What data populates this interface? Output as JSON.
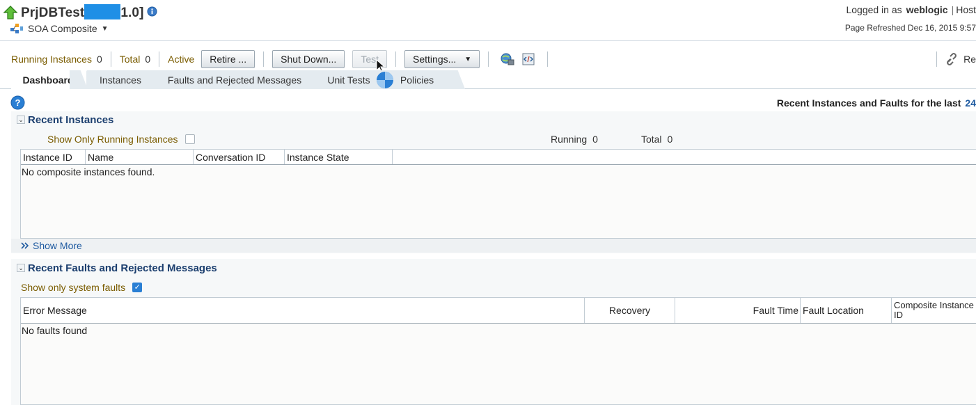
{
  "header": {
    "title_prefix": "PrjDBTest",
    "title_suffix": "1.0]",
    "subtitle": "SOA Composite",
    "logged_in_label": "Logged in as",
    "user": "weblogic",
    "host_label": "Host",
    "page_refreshed": "Page Refreshed Dec 16, 2015 9:57"
  },
  "toolbar": {
    "running_label": "Running Instances",
    "running_value": "0",
    "total_label": "Total",
    "total_value": "0",
    "active_label": "Active",
    "retire_button": "Retire ...",
    "shutdown_button": "Shut Down...",
    "test_button": "Test",
    "settings_button": "Settings...",
    "right_link": "Re"
  },
  "tabs": [
    {
      "label": "Dashboard",
      "active": true
    },
    {
      "label": "Instances",
      "active": false
    },
    {
      "label": "Faults and Rejected Messages",
      "active": false
    },
    {
      "label": "Unit Tests",
      "active": false
    },
    {
      "label": "Policies",
      "active": false
    }
  ],
  "dashboard": {
    "recent_header": "Recent Instances and Faults for the last",
    "recent_header_value": "24"
  },
  "recent_instances": {
    "title": "Recent Instances",
    "show_only_running_label": "Show Only Running Instances",
    "show_only_running_checked": false,
    "running_label": "Running",
    "running_value": "0",
    "total_label": "Total",
    "total_value": "0",
    "columns": [
      "Instance ID",
      "Name",
      "Conversation ID",
      "Instance State"
    ],
    "empty_message": "No composite instances found.",
    "show_more": "Show More"
  },
  "recent_faults": {
    "title": "Recent Faults and Rejected Messages",
    "show_system_faults_label": "Show only system faults",
    "show_system_faults_checked": true,
    "columns": [
      "Error Message",
      "Recovery",
      "Fault Time",
      "Fault Location",
      "Composite Instance",
      "ID"
    ],
    "empty_message": "No faults found"
  },
  "colors": {
    "accent": "#1b3e6e",
    "link": "#1e5aa0",
    "label": "#7a5c00",
    "checkbox_on": "#2a7fd4",
    "tab_bg": "#e4ebf0"
  }
}
